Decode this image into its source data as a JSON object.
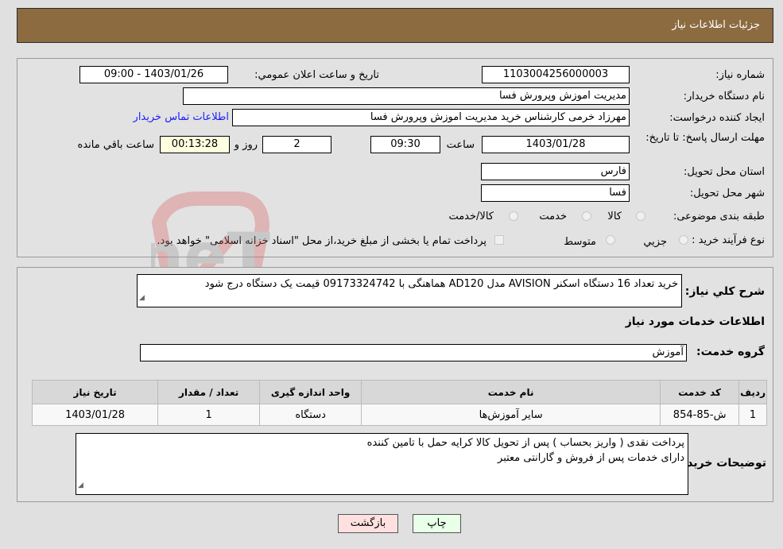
{
  "header": {
    "title": "جزئيات اطلاعات نياز"
  },
  "form": {
    "need_number_label": "شماره نیاز:",
    "need_number": "1103004256000003",
    "announce_label": "تاريخ و ساعت اعلان عمومي:",
    "announce_value": "1403/01/26 - 09:00",
    "buyer_org_label": "نام دستگاه خریدار:",
    "buyer_org": "مدیریت اموزش وپرورش فسا",
    "creator_label": "ایجاد کننده درخواست:",
    "creator": "مهرزاد خرمی کارشناس خرید مدیریت اموزش وپرورش فسا",
    "contact_link": "اطلاعات تماس خریدار",
    "deadline_label": "مهلت ارسال پاسخ: تا تاریخ:",
    "deadline_date": "1403/01/28",
    "time_label": "ساعت",
    "deadline_time": "09:30",
    "days_value": "2",
    "days_label": "روز و",
    "remaining_time": "00:13:28",
    "remaining_label": "ساعت باقي مانده",
    "province_label": "استان محل تحویل:",
    "province": "فارس",
    "city_label": "شهر محل تحویل:",
    "city": "فسا",
    "category_label": "طبقه بندی موضوعی:",
    "category_options": [
      "کالا",
      "خدمت",
      "کالا/خدمت"
    ],
    "category_selected": "خدمت",
    "process_label": "نوع فرآیند خرید :",
    "process_options": [
      "جزیي",
      "متوسط"
    ],
    "process_note": "پرداخت تمام یا بخشی از مبلغ خرید،از محل \"اسناد خزانه اسلامی\" خواهد بود."
  },
  "details": {
    "description_label": "شرح کلي نياز:",
    "description": "خرید تعداد 16 دستگاه اسکنر AVISION مدل AD120 هماهنگی با 09173324742 قیمت یک دستگاه درج شود",
    "services_heading": "اطلاعات خدمات مورد نیاز",
    "service_group_label": "گروه خدمت:",
    "service_group": "آموزش",
    "table": {
      "headers": [
        "ردیف",
        "کد خدمت",
        "نام خدمت",
        "واحد اندازه گیری",
        "تعداد / مقدار",
        "تاریخ نیاز"
      ],
      "rows": [
        [
          "1",
          "ش-85-854",
          "سایر آموزش‌ها",
          "دستگاه",
          "1",
          "1403/01/28"
        ]
      ]
    },
    "buyer_notes_label": "توضیحات خریدار:",
    "buyer_notes_line1": "پرداخت نقدی ( واریز بحساب ) پس از تحویل کالا کرایه حمل با تامین کننده",
    "buyer_notes_line2": "دارای خدمات پس از فروش و گارانتی معتبر"
  },
  "buttons": {
    "print": "چاپ",
    "back": "بازگشت"
  },
  "watermark": {
    "text": "AriaTender.neT"
  }
}
